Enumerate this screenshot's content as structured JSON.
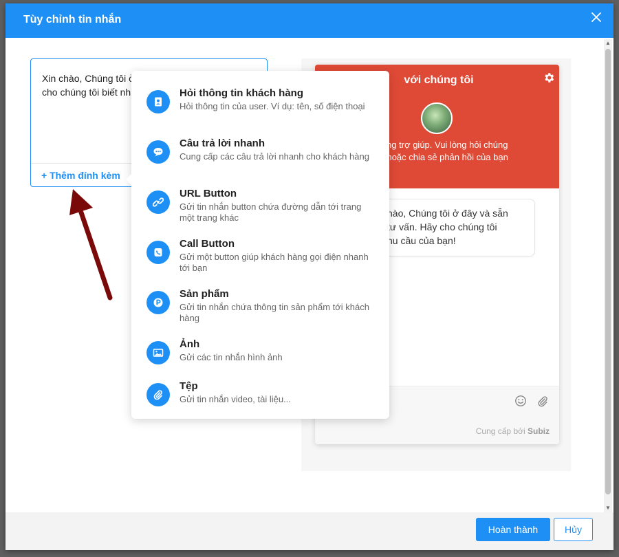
{
  "modal": {
    "title": "Tùy chỉnh tin nhắn",
    "close_icon": "close-icon"
  },
  "editor": {
    "message": "Xin chào, Chúng tôi ở đây và sẵn sàng tư vấn. Hãy cho chúng tôi biết nhu cầu của bạn!",
    "attach_label": "Thêm đính kèm",
    "attach_icon": "plus-icon"
  },
  "attachment_menu": {
    "items": [
      {
        "title": "Hỏi thông tin khách hàng",
        "description": "Hỏi thông tin của user. Ví dụ: tên, số điện thoại",
        "icon": "contact-card-icon"
      },
      {
        "title": "Câu trả lời nhanh",
        "description": "Cung cấp các câu trả lời nhanh cho khách hàng",
        "icon": "chat-bubble-icon"
      },
      {
        "title": "URL Button",
        "description": "Gửi tin nhắn button chứa đường dẫn tới trang một trang khác",
        "icon": "link-icon"
      },
      {
        "title": "Call Button",
        "description": "Gửi một button giúp khách hàng gọi điện nhanh tới bạn",
        "icon": "phone-icon"
      },
      {
        "title": "Sản phẩm",
        "description": "Gửi tin nhắn chứa thông tin sản phẩm tới khách hàng",
        "icon": "product-icon"
      },
      {
        "title": "Ảnh",
        "description": "Gửi các tin nhắn hình ảnh",
        "icon": "image-icon"
      },
      {
        "title": "Tệp",
        "description": "Gửi tin nhắn video, tài liệu...",
        "icon": "paperclip-icon"
      }
    ]
  },
  "preview": {
    "header_title": "với chúng tôi",
    "header_subtitle": "n sàng trợ giúp. Vui lòng hỏi chúng\nu gì hoặc chia sẻ phản hồi của bạn",
    "bubble_text": "hào, Chúng tôi ở đây và sẵn\ntư vấn. Hãy cho chúng tôi\nhu cầu của bạn!",
    "composer_placeholder": ".",
    "powered_prefix": "Cung cấp bởi",
    "powered_brand": "Subiz",
    "header_color": "#df4a36"
  },
  "footer": {
    "done_label": "Hoàn thành",
    "cancel_label": "Hủy"
  },
  "colors": {
    "accent": "#1e90f5",
    "annotation_arrow": "#7a0a0a"
  }
}
